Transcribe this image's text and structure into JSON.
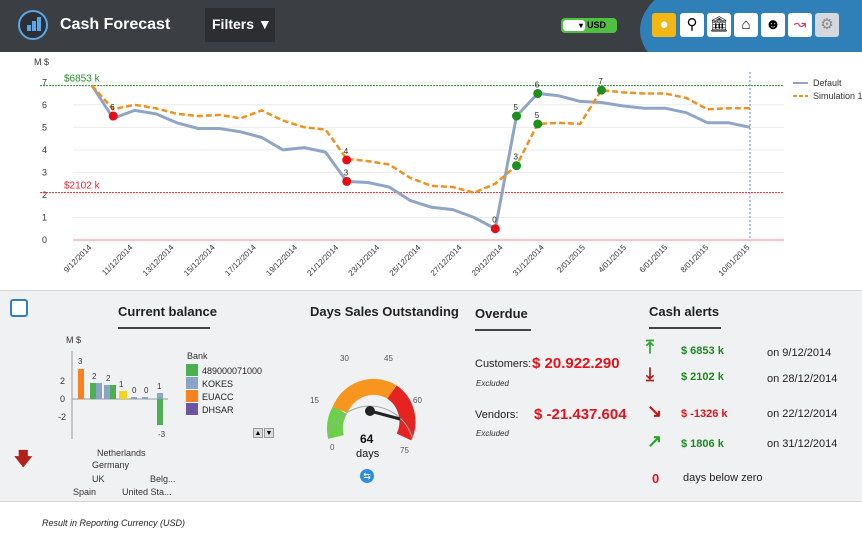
{
  "header": {
    "app_title": "Cash Forecast",
    "filters_label": "Filters",
    "currency": "USD",
    "toolbar_icons": [
      "shield-icon",
      "search-icon",
      "bank-icon",
      "chart-house-icon",
      "people-icon",
      "trend-icon",
      "gear-icon"
    ]
  },
  "chart_data": {
    "type": "line",
    "ylabel": "M $",
    "ylim": [
      0,
      8
    ],
    "yticks": [
      "0",
      "1",
      "2",
      "3",
      "4",
      "5",
      "6",
      "7"
    ],
    "categories": [
      "9/12/2014",
      "11/12/2014",
      "13/12/2014",
      "15/12/2014",
      "17/12/2014",
      "19/12/2014",
      "21/12/2014",
      "23/12/2014",
      "25/12/2014",
      "27/12/2014",
      "29/12/2014",
      "31/12/2014",
      "2/01/2015",
      "4/01/2015",
      "6/01/2015",
      "8/01/2015",
      "10/01/2015"
    ],
    "series": [
      {
        "name": "Default",
        "color": "#8fa5c8",
        "values": [
          6.85,
          5.4,
          5.75,
          5.6,
          5.2,
          4.95,
          4.95,
          4.8,
          4.55,
          4.0,
          4.1,
          3.9,
          2.6,
          2.55,
          2.35,
          1.75,
          1.45,
          1.35,
          1.0,
          0.5,
          5.5,
          6.5,
          6.4,
          6.15,
          6.1,
          5.95,
          5.85,
          5.85,
          5.65,
          5.2,
          5.2,
          5.0
        ]
      },
      {
        "name": "Simulation 1",
        "color": "#f0901e",
        "values": [
          6.85,
          5.8,
          6.0,
          5.85,
          5.6,
          5.5,
          5.55,
          5.4,
          5.75,
          5.3,
          5.0,
          4.9,
          3.6,
          3.5,
          3.35,
          2.75,
          2.4,
          2.35,
          2.1,
          2.5,
          3.3,
          5.15,
          5.2,
          5.15,
          6.65,
          6.55,
          6.5,
          6.5,
          6.3,
          5.8,
          5.85,
          5.85
        ]
      }
    ],
    "reference_lines": [
      {
        "label": "$6853 k",
        "value": 6.853,
        "color": "#2a8b2a"
      },
      {
        "label": "$2102 k",
        "value": 2.102,
        "color": "#e0262c"
      }
    ],
    "markers": [
      {
        "label": "6",
        "idx": 1,
        "value": 5.5,
        "color": "#e30e17"
      },
      {
        "label": "4",
        "idx": 12,
        "value": 3.55,
        "color": "#e30e17"
      },
      {
        "label": "3",
        "idx": 12,
        "value": 2.6,
        "color": "#e30e17"
      },
      {
        "label": "0",
        "idx": 19,
        "value": 0.5,
        "color": "#e30e17"
      },
      {
        "label": "3",
        "idx": 20,
        "value": 3.3,
        "color": "#1a8f1a"
      },
      {
        "label": "5",
        "idx": 20,
        "value": 5.5,
        "color": "#1a8f1a"
      },
      {
        "label": "6",
        "idx": 21,
        "value": 6.5,
        "color": "#1a8f1a"
      },
      {
        "label": "5",
        "idx": 21,
        "value": 5.15,
        "color": "#1a8f1a"
      },
      {
        "label": "7",
        "idx": 24,
        "value": 6.65,
        "color": "#1a8f1a"
      }
    ]
  },
  "current_balance": {
    "title": "Current balance",
    "unit": "M $",
    "yticks": [
      "2",
      "0",
      "-2"
    ],
    "bar_labels": [
      "3",
      "2",
      "2",
      "1",
      "0",
      "0",
      "1",
      "-3"
    ],
    "legend_title": "Bank",
    "legend": [
      {
        "name": "489000071000",
        "color": "#4caf50"
      },
      {
        "name": "KOKES",
        "color": "#8aa4c8"
      },
      {
        "name": "EUACC",
        "color": "#f5821f"
      },
      {
        "name": "DHSAR",
        "color": "#6b56a3"
      }
    ],
    "countries": [
      "Netherlands",
      "Germany",
      "UK",
      "Belg...",
      "Spain",
      "United Sta..."
    ]
  },
  "dso": {
    "title": "Days Sales Outstanding",
    "ticks": [
      "0",
      "15",
      "30",
      "45",
      "60",
      "75"
    ],
    "value": 64,
    "unit": "days"
  },
  "overdue": {
    "title": "Overdue",
    "customers_label": "Customers:",
    "customers_value": "$ 20.922.290",
    "vendors_label": "Vendors:",
    "vendors_value": "$ -21.437.604",
    "excluded": "Excluded"
  },
  "cash_alerts": {
    "title": "Cash alerts",
    "items": [
      {
        "value": "$ 6853 k",
        "date": "on 9/12/2014",
        "color": "#1c8a1c"
      },
      {
        "value": "$ 2102 k",
        "date": "on 28/12/2014",
        "color": "#1c8a1c"
      },
      {
        "value": "$ -1326 k",
        "date": "on 22/12/2014",
        "color": "#e3121b"
      },
      {
        "value": "$ 1806 k",
        "date": "on 31/12/2014",
        "color": "#1c8a1c"
      }
    ],
    "zero_days": "0",
    "zero_label": "days below zero"
  },
  "footer": {
    "text": "Result in Reporting Currency (USD)"
  }
}
